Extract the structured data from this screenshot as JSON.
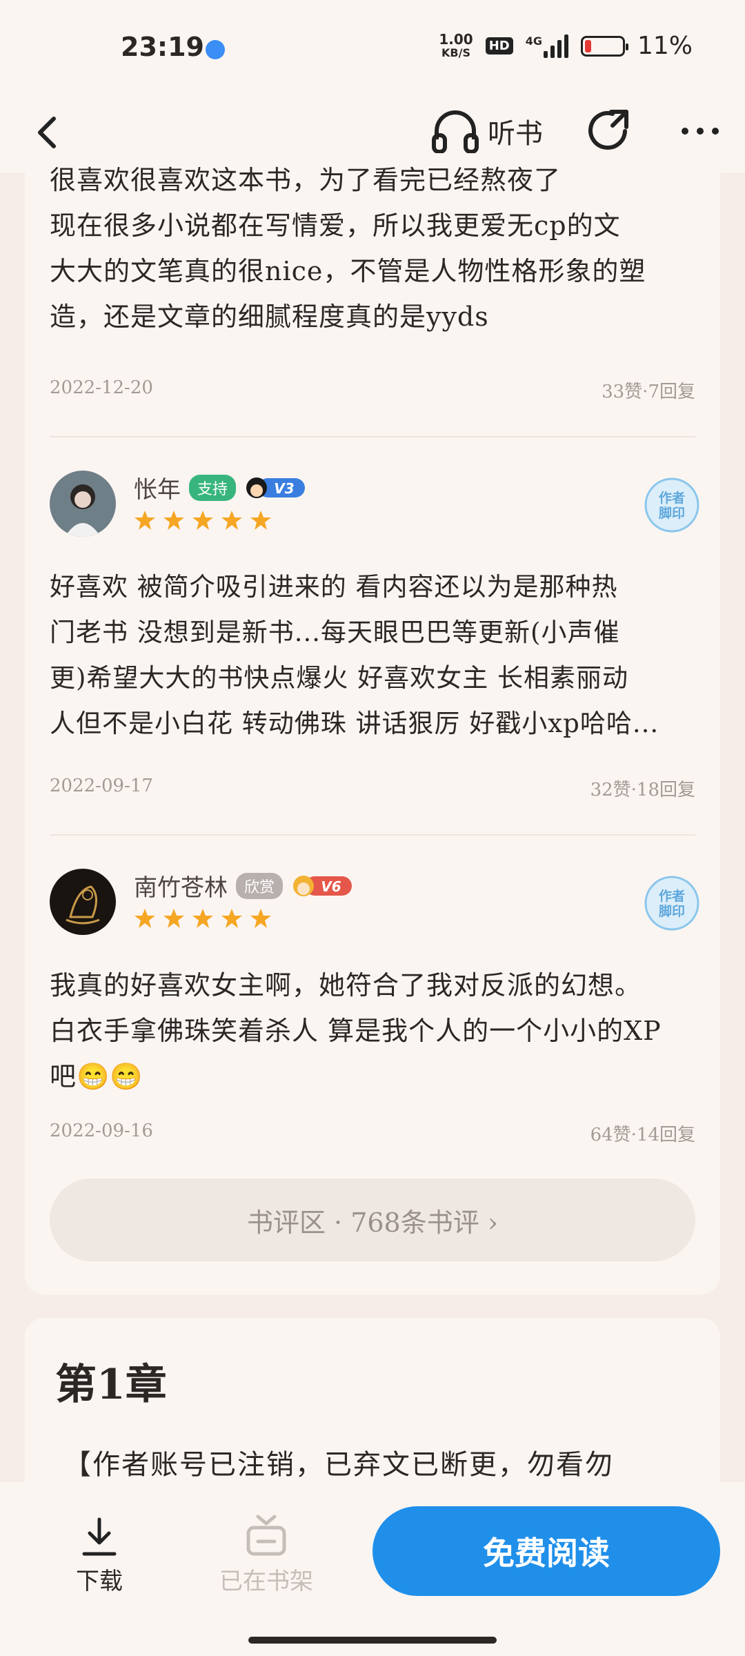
{
  "status": {
    "time": "23:19",
    "speed_top": "1.00",
    "speed_bottom": "KB/S",
    "hd": "HD",
    "network": "4G",
    "battery": "11%"
  },
  "nav": {
    "listen_label": "听书"
  },
  "reviews": [
    {
      "text": "很喜欢很喜欢这本书，为了看完已经熬夜了\n现在很多小说都在写情爱，所以我更爱无cp的文\n大大的文笔真的很nice，不管是人物性格形象的塑\n造，还是文章的细腻程度真的是yyds",
      "date": "2022-12-20",
      "stats": "33赞·7回复"
    },
    {
      "user": "怅年",
      "tag": "支持",
      "vip": "V3",
      "rating": 5,
      "stamp": "作者脚印",
      "text": "好喜欢 被简介吸引进来的 看内容还以为是那种热\n门老书 没想到是新书...每天眼巴巴等更新(小声催\n更)希望大大的书快点爆火 好喜欢女主 长相素丽动\n人但不是小白花 转动佛珠 讲话狠厉 好戳小xp哈哈...",
      "date": "2022-09-17",
      "stats": "32赞·18回复"
    },
    {
      "user": "南竹苍林",
      "tag": "欣赏",
      "vip": "V6",
      "rating": 5,
      "stamp": "作者脚印",
      "text": "我真的好喜欢女主啊，她符合了我对反派的幻想。\n白衣手拿佛珠笑着杀人 算是我个人的一个小小的XP\n吧😁😁",
      "date": "2022-09-16",
      "stats": "64赞·14回复"
    }
  ],
  "more_reviews": "书评区 · 768条书评 ›",
  "chapter": {
    "title": "第1章",
    "preview": "【作者账号已注销，已弃文已断更，勿看勿"
  },
  "bottom": {
    "download_label": "下载",
    "shelf_label": "已在书架",
    "read_label": "免费阅读"
  },
  "colors": {
    "accent": "#1f8fea",
    "tag_support": "#37b57d",
    "tag_appreciate": "#b8b0ac",
    "star": "#f5a623"
  }
}
